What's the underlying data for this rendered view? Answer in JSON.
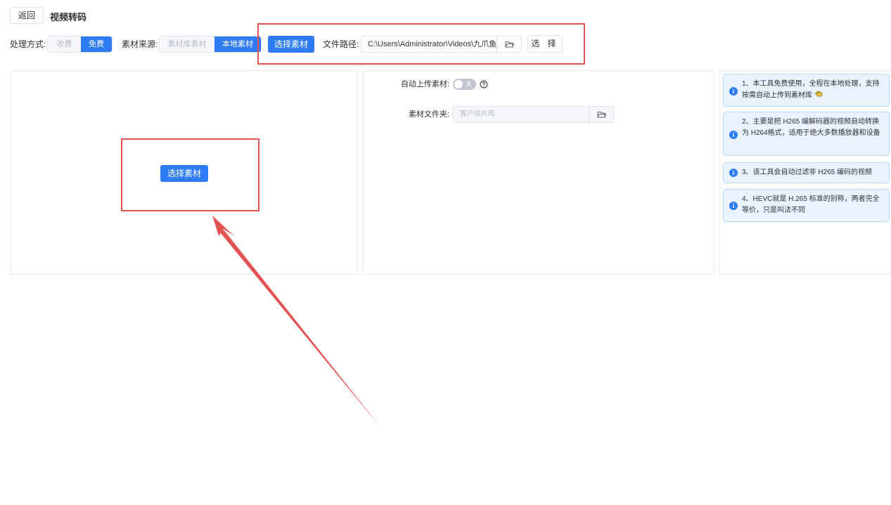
{
  "header": {
    "back_label": "返回",
    "title": "视频转码"
  },
  "toolbar": {
    "mode_label": "处理方式:",
    "mode_options": [
      "收费",
      "免费"
    ],
    "mode_selected": "免费",
    "source_label": "素材来源:",
    "source_options": [
      "素材库素材",
      "本地素材"
    ],
    "source_selected": "本地素材",
    "select_material_label": "选择素材",
    "file_path_label": "文件路径:",
    "file_path_value": "C:\\Users\\Administrator\\Videos\\九爪鱼",
    "choose_label": "选 择"
  },
  "left_panel": {
    "select_material_label": "选择素材"
  },
  "middle_panel": {
    "auto_upload_label": "自动上传素材:",
    "toggle_text": "关",
    "folder_label": "素材文件夹:",
    "folder_placeholder": "客户成片库"
  },
  "tips": [
    "1、本工具免费使用，全程在本地处理，支持按需自动上传到素材库",
    "2、主要是把 H265 编解码器的视频自动转换为 H264格式，适用于绝大多数播放器和设备",
    "3、该工具会自动过滤非 H265 编码的视频",
    "4、HEVC就是 H.265 标准的别称，两者完全等价，只是叫法不同"
  ],
  "colors": {
    "primary": "#2d7cf6",
    "annotation_red": "#e35353",
    "tip_bg": "#e8f3ff"
  },
  "icons": [
    "folder-icon",
    "help-circle-icon",
    "info-icon",
    "pointing-hand-icon"
  ]
}
